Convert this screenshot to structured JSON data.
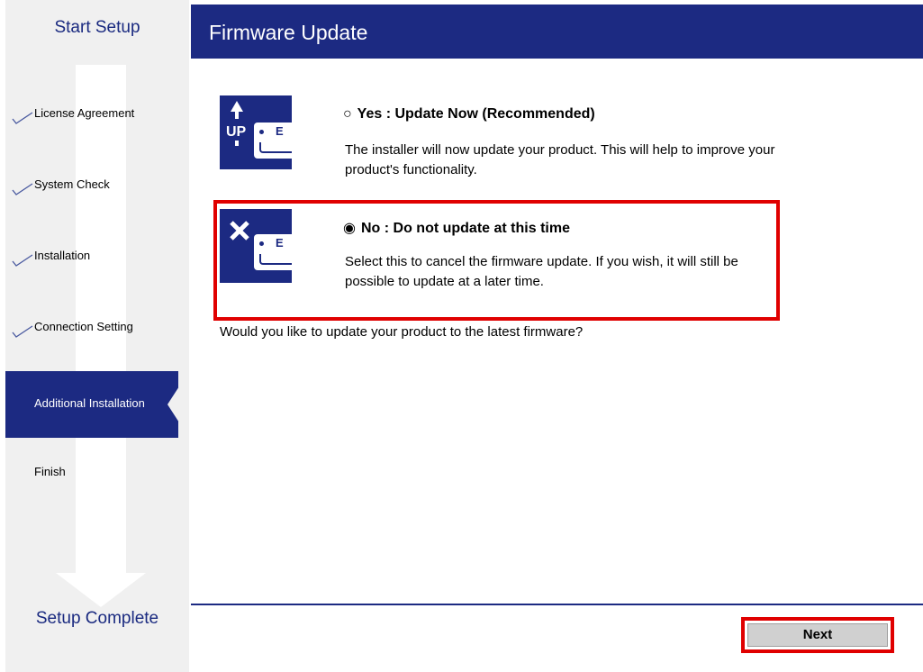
{
  "sidebar": {
    "title": "Start Setup",
    "steps": [
      {
        "label": "License Agreement",
        "state": "done"
      },
      {
        "label": "System Check",
        "state": "done"
      },
      {
        "label": "Installation",
        "state": "done"
      },
      {
        "label": "Connection Setting",
        "state": "done"
      },
      {
        "label": "Additional Installation",
        "state": "active"
      },
      {
        "label": "Finish",
        "state": "pending"
      }
    ],
    "bottom": "Setup Complete"
  },
  "header": {
    "title": "Firmware Update"
  },
  "options": [
    {
      "icon": "update-up-icon",
      "radio": "○",
      "heading": "Yes : Update Now (Recommended)",
      "description": "The installer will now update your product. This will help to improve your product's functionality.",
      "selected": false
    },
    {
      "icon": "cancel-x-icon",
      "radio": "◉",
      "heading": "No : Do not update at this time",
      "description": "Select this to cancel the firmware update.  If you wish, it will still be possible to update at a later time.",
      "selected": true
    }
  ],
  "question": "Would you like to update your product to the latest firmware?",
  "footer": {
    "next_label": "Next"
  },
  "colors": {
    "brand": "#1c2a82",
    "highlight": "#e00000",
    "sidebar_bg": "#f0f0f0"
  }
}
